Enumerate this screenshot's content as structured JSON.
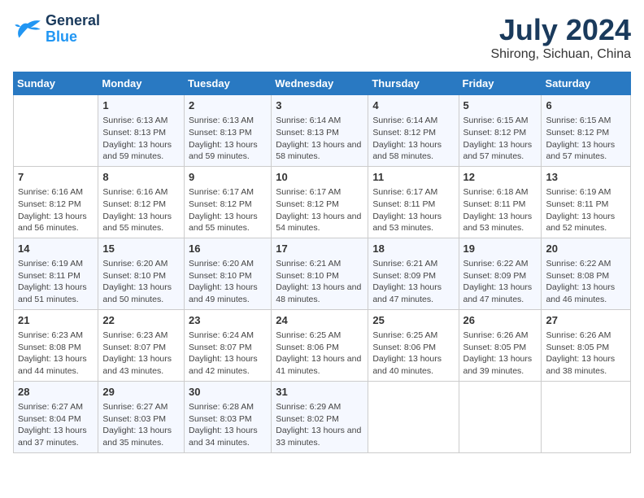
{
  "header": {
    "logo_line1": "General",
    "logo_line2": "Blue",
    "title": "July 2024",
    "subtitle": "Shirong, Sichuan, China"
  },
  "days": [
    "Sunday",
    "Monday",
    "Tuesday",
    "Wednesday",
    "Thursday",
    "Friday",
    "Saturday"
  ],
  "weeks": [
    [
      {
        "date": "",
        "sunrise": "",
        "sunset": "",
        "daylight": ""
      },
      {
        "date": "1",
        "sunrise": "Sunrise: 6:13 AM",
        "sunset": "Sunset: 8:13 PM",
        "daylight": "Daylight: 13 hours and 59 minutes."
      },
      {
        "date": "2",
        "sunrise": "Sunrise: 6:13 AM",
        "sunset": "Sunset: 8:13 PM",
        "daylight": "Daylight: 13 hours and 59 minutes."
      },
      {
        "date": "3",
        "sunrise": "Sunrise: 6:14 AM",
        "sunset": "Sunset: 8:13 PM",
        "daylight": "Daylight: 13 hours and 58 minutes."
      },
      {
        "date": "4",
        "sunrise": "Sunrise: 6:14 AM",
        "sunset": "Sunset: 8:12 PM",
        "daylight": "Daylight: 13 hours and 58 minutes."
      },
      {
        "date": "5",
        "sunrise": "Sunrise: 6:15 AM",
        "sunset": "Sunset: 8:12 PM",
        "daylight": "Daylight: 13 hours and 57 minutes."
      },
      {
        "date": "6",
        "sunrise": "Sunrise: 6:15 AM",
        "sunset": "Sunset: 8:12 PM",
        "daylight": "Daylight: 13 hours and 57 minutes."
      }
    ],
    [
      {
        "date": "7",
        "sunrise": "Sunrise: 6:16 AM",
        "sunset": "Sunset: 8:12 PM",
        "daylight": "Daylight: 13 hours and 56 minutes."
      },
      {
        "date": "8",
        "sunrise": "Sunrise: 6:16 AM",
        "sunset": "Sunset: 8:12 PM",
        "daylight": "Daylight: 13 hours and 55 minutes."
      },
      {
        "date": "9",
        "sunrise": "Sunrise: 6:17 AM",
        "sunset": "Sunset: 8:12 PM",
        "daylight": "Daylight: 13 hours and 55 minutes."
      },
      {
        "date": "10",
        "sunrise": "Sunrise: 6:17 AM",
        "sunset": "Sunset: 8:12 PM",
        "daylight": "Daylight: 13 hours and 54 minutes."
      },
      {
        "date": "11",
        "sunrise": "Sunrise: 6:17 AM",
        "sunset": "Sunset: 8:11 PM",
        "daylight": "Daylight: 13 hours and 53 minutes."
      },
      {
        "date": "12",
        "sunrise": "Sunrise: 6:18 AM",
        "sunset": "Sunset: 8:11 PM",
        "daylight": "Daylight: 13 hours and 53 minutes."
      },
      {
        "date": "13",
        "sunrise": "Sunrise: 6:19 AM",
        "sunset": "Sunset: 8:11 PM",
        "daylight": "Daylight: 13 hours and 52 minutes."
      }
    ],
    [
      {
        "date": "14",
        "sunrise": "Sunrise: 6:19 AM",
        "sunset": "Sunset: 8:11 PM",
        "daylight": "Daylight: 13 hours and 51 minutes."
      },
      {
        "date": "15",
        "sunrise": "Sunrise: 6:20 AM",
        "sunset": "Sunset: 8:10 PM",
        "daylight": "Daylight: 13 hours and 50 minutes."
      },
      {
        "date": "16",
        "sunrise": "Sunrise: 6:20 AM",
        "sunset": "Sunset: 8:10 PM",
        "daylight": "Daylight: 13 hours and 49 minutes."
      },
      {
        "date": "17",
        "sunrise": "Sunrise: 6:21 AM",
        "sunset": "Sunset: 8:10 PM",
        "daylight": "Daylight: 13 hours and 48 minutes."
      },
      {
        "date": "18",
        "sunrise": "Sunrise: 6:21 AM",
        "sunset": "Sunset: 8:09 PM",
        "daylight": "Daylight: 13 hours and 47 minutes."
      },
      {
        "date": "19",
        "sunrise": "Sunrise: 6:22 AM",
        "sunset": "Sunset: 8:09 PM",
        "daylight": "Daylight: 13 hours and 47 minutes."
      },
      {
        "date": "20",
        "sunrise": "Sunrise: 6:22 AM",
        "sunset": "Sunset: 8:08 PM",
        "daylight": "Daylight: 13 hours and 46 minutes."
      }
    ],
    [
      {
        "date": "21",
        "sunrise": "Sunrise: 6:23 AM",
        "sunset": "Sunset: 8:08 PM",
        "daylight": "Daylight: 13 hours and 44 minutes."
      },
      {
        "date": "22",
        "sunrise": "Sunrise: 6:23 AM",
        "sunset": "Sunset: 8:07 PM",
        "daylight": "Daylight: 13 hours and 43 minutes."
      },
      {
        "date": "23",
        "sunrise": "Sunrise: 6:24 AM",
        "sunset": "Sunset: 8:07 PM",
        "daylight": "Daylight: 13 hours and 42 minutes."
      },
      {
        "date": "24",
        "sunrise": "Sunrise: 6:25 AM",
        "sunset": "Sunset: 8:06 PM",
        "daylight": "Daylight: 13 hours and 41 minutes."
      },
      {
        "date": "25",
        "sunrise": "Sunrise: 6:25 AM",
        "sunset": "Sunset: 8:06 PM",
        "daylight": "Daylight: 13 hours and 40 minutes."
      },
      {
        "date": "26",
        "sunrise": "Sunrise: 6:26 AM",
        "sunset": "Sunset: 8:05 PM",
        "daylight": "Daylight: 13 hours and 39 minutes."
      },
      {
        "date": "27",
        "sunrise": "Sunrise: 6:26 AM",
        "sunset": "Sunset: 8:05 PM",
        "daylight": "Daylight: 13 hours and 38 minutes."
      }
    ],
    [
      {
        "date": "28",
        "sunrise": "Sunrise: 6:27 AM",
        "sunset": "Sunset: 8:04 PM",
        "daylight": "Daylight: 13 hours and 37 minutes."
      },
      {
        "date": "29",
        "sunrise": "Sunrise: 6:27 AM",
        "sunset": "Sunset: 8:03 PM",
        "daylight": "Daylight: 13 hours and 35 minutes."
      },
      {
        "date": "30",
        "sunrise": "Sunrise: 6:28 AM",
        "sunset": "Sunset: 8:03 PM",
        "daylight": "Daylight: 13 hours and 34 minutes."
      },
      {
        "date": "31",
        "sunrise": "Sunrise: 6:29 AM",
        "sunset": "Sunset: 8:02 PM",
        "daylight": "Daylight: 13 hours and 33 minutes."
      },
      {
        "date": "",
        "sunrise": "",
        "sunset": "",
        "daylight": ""
      },
      {
        "date": "",
        "sunrise": "",
        "sunset": "",
        "daylight": ""
      },
      {
        "date": "",
        "sunrise": "",
        "sunset": "",
        "daylight": ""
      }
    ]
  ]
}
